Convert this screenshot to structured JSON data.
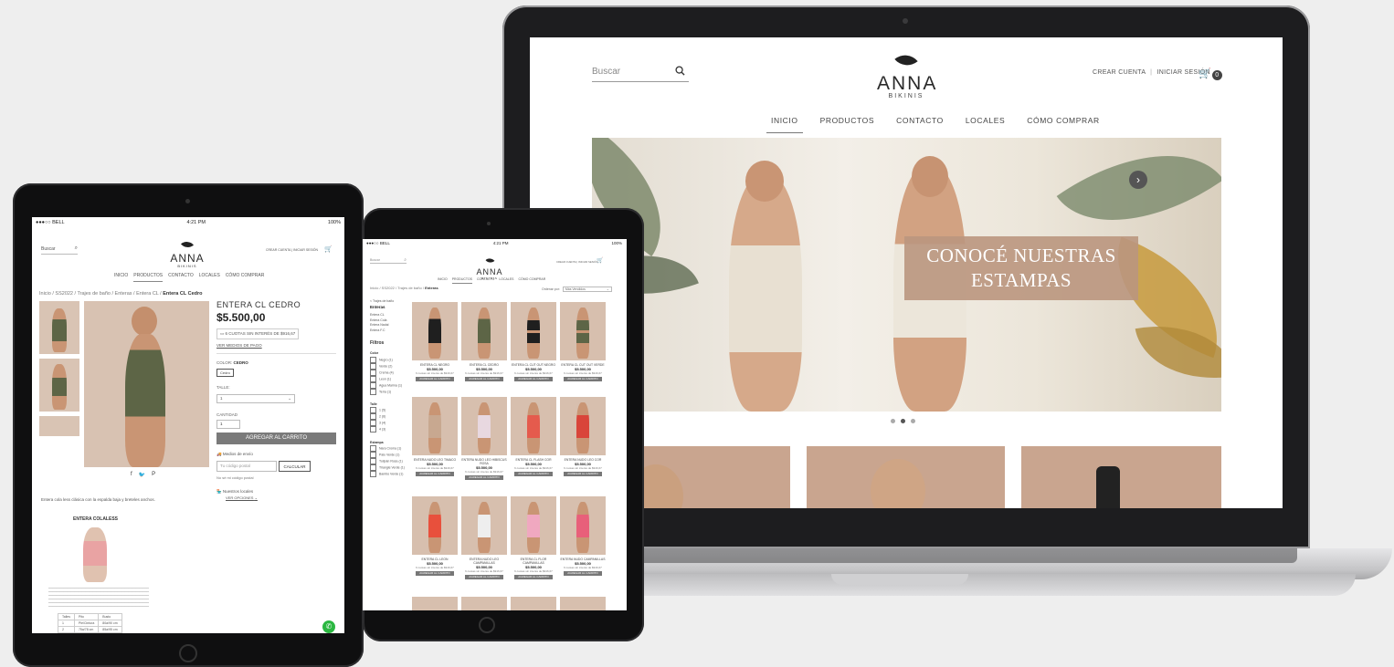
{
  "laptop": {
    "search_placeholder": "Buscar",
    "brand": "ANNA",
    "brand_sub": "BIKINIS",
    "create_account": "CREAR CUENTA",
    "login": "INICIAR SESIÓN",
    "cart_count": "0",
    "nav": [
      "INICIO",
      "PRODUCTOS",
      "CONTACTO",
      "LOCALES",
      "CÓMO COMPRAR"
    ],
    "promo_line1": "CONOCÉ NUESTRAS",
    "promo_line2": "ESTAMPAS"
  },
  "tablet_left": {
    "carrier": "●●●○○ BELL",
    "time": "4:21 PM",
    "battery": "100%",
    "search_placeholder": "Buscar",
    "brand": "ANNA",
    "brand_sub": "BIKINIS",
    "nav": [
      "INICIO",
      "PRODUCTOS",
      "CONTACTO",
      "LOCALES",
      "CÓMO COMPRAR"
    ],
    "breadcrumb": "Inicio / SS2022 / Trajes de baño / Enteras / Entera CL /",
    "breadcrumb_current": "Entera CL Cedro",
    "product_title": "ENTERA CL CEDRO",
    "price": "$5.500,00",
    "installments": "6 CUOTAS SIN INTERÉS DE $916,67",
    "payment_link": "VER MEDIOS DE PAGO",
    "color_label": "COLOR:",
    "color_value": "CEDRO",
    "color_option": "Cedro",
    "size_label": "TALLE:",
    "size_value": "1",
    "qty_label": "CANTIDAD",
    "qty_value": "1",
    "add_to_cart": "AGREGAR AL CARRITO",
    "shipping_label": "Medios de envío",
    "zip_placeholder": "Tu código postal",
    "calc_button": "CALCULAR",
    "no_zip": "No sé mi código postal",
    "stores_label": "Nuestros locales",
    "stores_link": "VER OPCIONES",
    "description": "Entera cola less clásica con la espalda baja y breteles anchos.",
    "guide_title": "ENTERA COLALESS",
    "table_headers": [
      "Talles",
      "Pito",
      "Busto"
    ],
    "table_rows": [
      [
        "1",
        "Pie/Cintura",
        "80a/90 cm"
      ],
      [
        "2",
        "75a/78 cm",
        "85a/95 cm"
      ]
    ]
  },
  "tablet_right": {
    "carrier": "●●●○○ BELL",
    "time": "4:21 PM",
    "battery": "100%",
    "search_placeholder": "Buscar",
    "brand": "ANNA",
    "brand_sub": "BIKINIS",
    "nav": [
      "INICIO",
      "PRODUCTOS",
      "CONTACTO",
      "LOCALES",
      "CÓMO COMPRAR"
    ],
    "breadcrumb": "Inicio / SS2022 / Trajes de baño /",
    "breadcrumb_current": "Enteras",
    "sort_label": "Ordenar por:",
    "sort_value": "Más Vendidos",
    "category_parent": "< Trajes de baño",
    "category": "Enteras",
    "subcategories": [
      "Entera CL",
      "Entera Cola",
      "Entera Nadal",
      "Entera F.C"
    ],
    "filters_title": "Filtros",
    "color_title": "Color",
    "colors": [
      "Negro (1)",
      "Verde (2)",
      "Crema (4)",
      "Leon (1)",
      "Agua Marina (1)",
      "Terra (1)"
    ],
    "size_title": "Talle",
    "sizes": [
      "1 (5)",
      "2 (6)",
      "3 (4)",
      "4 (3)"
    ],
    "print_title": "Estampa",
    "prints": [
      "Nara Croma (1)",
      "Palo Verde (1)",
      "Tulipán Rosa (1)",
      "Triangle Verde (1)",
      "Bambú Verde (1)"
    ],
    "products": [
      {
        "name": "ENTERA CL NEGRO",
        "price": "$5.500,00",
        "cuotas": "6 cuotas sin interés de $916,67",
        "btn": "AGREGAR AL CARRITO"
      },
      {
        "name": "ENTERA CL CEDRO",
        "price": "$5.500,00",
        "cuotas": "6 cuotas sin interés de $916,67",
        "btn": "AGREGAR AL CARRITO"
      },
      {
        "name": "ENTERA CL CUT OUT NEGRO",
        "price": "$5.500,00",
        "cuotas": "6 cuotas sin interés de $916,67",
        "btn": "AGREGAR AL CARRITO"
      },
      {
        "name": "ENTERA CL CUT OUT VERDE",
        "price": "$5.500,00",
        "cuotas": "6 cuotas sin interés de $916,67",
        "btn": "AGREGAR AL CARRITO"
      },
      {
        "name": "ENTERA NUDO LEO TIMACO",
        "price": "$5.500,00",
        "cuotas": "6 cuotas sin interés de $916,67",
        "btn": "AGREGAR AL CARRITO"
      },
      {
        "name": "ENTERA NUDO LEO HIBISCUS ROSA",
        "price": "$5.500,00",
        "cuotas": "6 cuotas sin interés de $916,67",
        "btn": "AGREGAR AL CARRITO"
      },
      {
        "name": "ENTERA CL FLASH COR",
        "price": "$5.500,00",
        "cuotas": "6 cuotas sin interés de $916,67",
        "btn": "AGREGAR AL CARRITO"
      },
      {
        "name": "ENTERA NUDO LEO COR",
        "price": "$5.500,00",
        "cuotas": "6 cuotas sin interés de $916,67",
        "btn": "AGREGAR AL CARRITO"
      },
      {
        "name": "ENTERA CL LEON",
        "price": "$5.500,00",
        "cuotas": "6 cuotas sin interés de $916,67",
        "btn": "AGREGAR AL CARRITO"
      },
      {
        "name": "ENTERA NUDO LEO CAMPANILLAS",
        "price": "$5.500,00",
        "cuotas": "6 cuotas sin interés de $916,67",
        "btn": "AGREGAR AL CARRITO"
      },
      {
        "name": "ENTERA CL FLOR CAMPANILLAS",
        "price": "$5.500,00",
        "cuotas": "6 cuotas sin interés de $916,67",
        "btn": "AGREGAR AL CARRITO"
      },
      {
        "name": "ENTERA NUDO CAMPANILLAS",
        "price": "$5.500,00",
        "cuotas": "6 cuotas sin interés de $916,67",
        "btn": "AGREGAR AL CARRITO"
      }
    ]
  },
  "colors": {
    "accent_tan": "#ba967e",
    "dark": "#222222",
    "button_gray": "#7a7a7a"
  }
}
